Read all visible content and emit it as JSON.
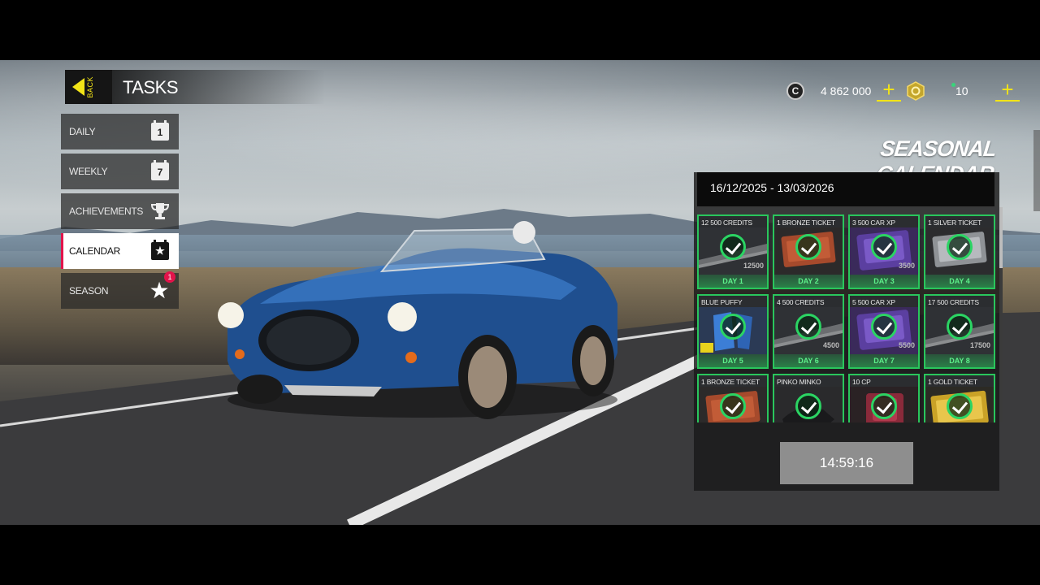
{
  "header": {
    "back_label": "BACK",
    "title": "TASKS"
  },
  "sidebar": {
    "items": [
      {
        "label": "DAILY",
        "icon": "calendar-1-icon",
        "icon_text": "1"
      },
      {
        "label": "WEEKLY",
        "icon": "calendar-7-icon",
        "icon_text": "7"
      },
      {
        "label": "ACHIEVEMENTS",
        "icon": "trophy-icon"
      },
      {
        "label": "CALENDAR",
        "icon": "calendar-star-icon",
        "active": true
      },
      {
        "label": "SEASON",
        "icon": "star-icon",
        "badge": "1"
      }
    ]
  },
  "currency": {
    "credits": "4 862 000",
    "cp": "10",
    "plus": "+"
  },
  "calendar": {
    "title": "SEASONAL CALENDAR",
    "date_range": "16/12/2025 - 13/03/2026",
    "timer": "14:59:16",
    "rewards": [
      {
        "name": "12 500 CREDITS",
        "day": "DAY 1",
        "amount": "12500",
        "art": "credits"
      },
      {
        "name": "1 BRONZE TICKET",
        "day": "DAY 2",
        "amount": "",
        "art": "bronze"
      },
      {
        "name": "3 500 CAR XP",
        "day": "DAY 3",
        "amount": "3500",
        "art": "xp"
      },
      {
        "name": "1 SILVER TICKET",
        "day": "DAY 4",
        "amount": "",
        "art": "silver"
      },
      {
        "name": "BLUE PUFFY",
        "day": "DAY 5",
        "amount": "",
        "art": "puffy"
      },
      {
        "name": "4 500 CREDITS",
        "day": "DAY 6",
        "amount": "4500",
        "art": "credits"
      },
      {
        "name": "5 500 CAR XP",
        "day": "DAY 7",
        "amount": "5500",
        "art": "xp"
      },
      {
        "name": "17 500 CREDITS",
        "day": "DAY 8",
        "amount": "17500",
        "art": "credits"
      },
      {
        "name": "1 BRONZE TICKET",
        "day": "",
        "amount": "",
        "art": "bronze"
      },
      {
        "name": "PINKO MINKO",
        "day": "",
        "amount": "",
        "art": "pinko"
      },
      {
        "name": "10 CP",
        "day": "",
        "amount": "",
        "art": "cp"
      },
      {
        "name": "1 GOLD TICKET",
        "day": "",
        "amount": "",
        "art": "gold"
      }
    ]
  },
  "colors": {
    "accent": "#f2e417",
    "active_border": "#e2134a",
    "claimed": "#29c65c"
  }
}
